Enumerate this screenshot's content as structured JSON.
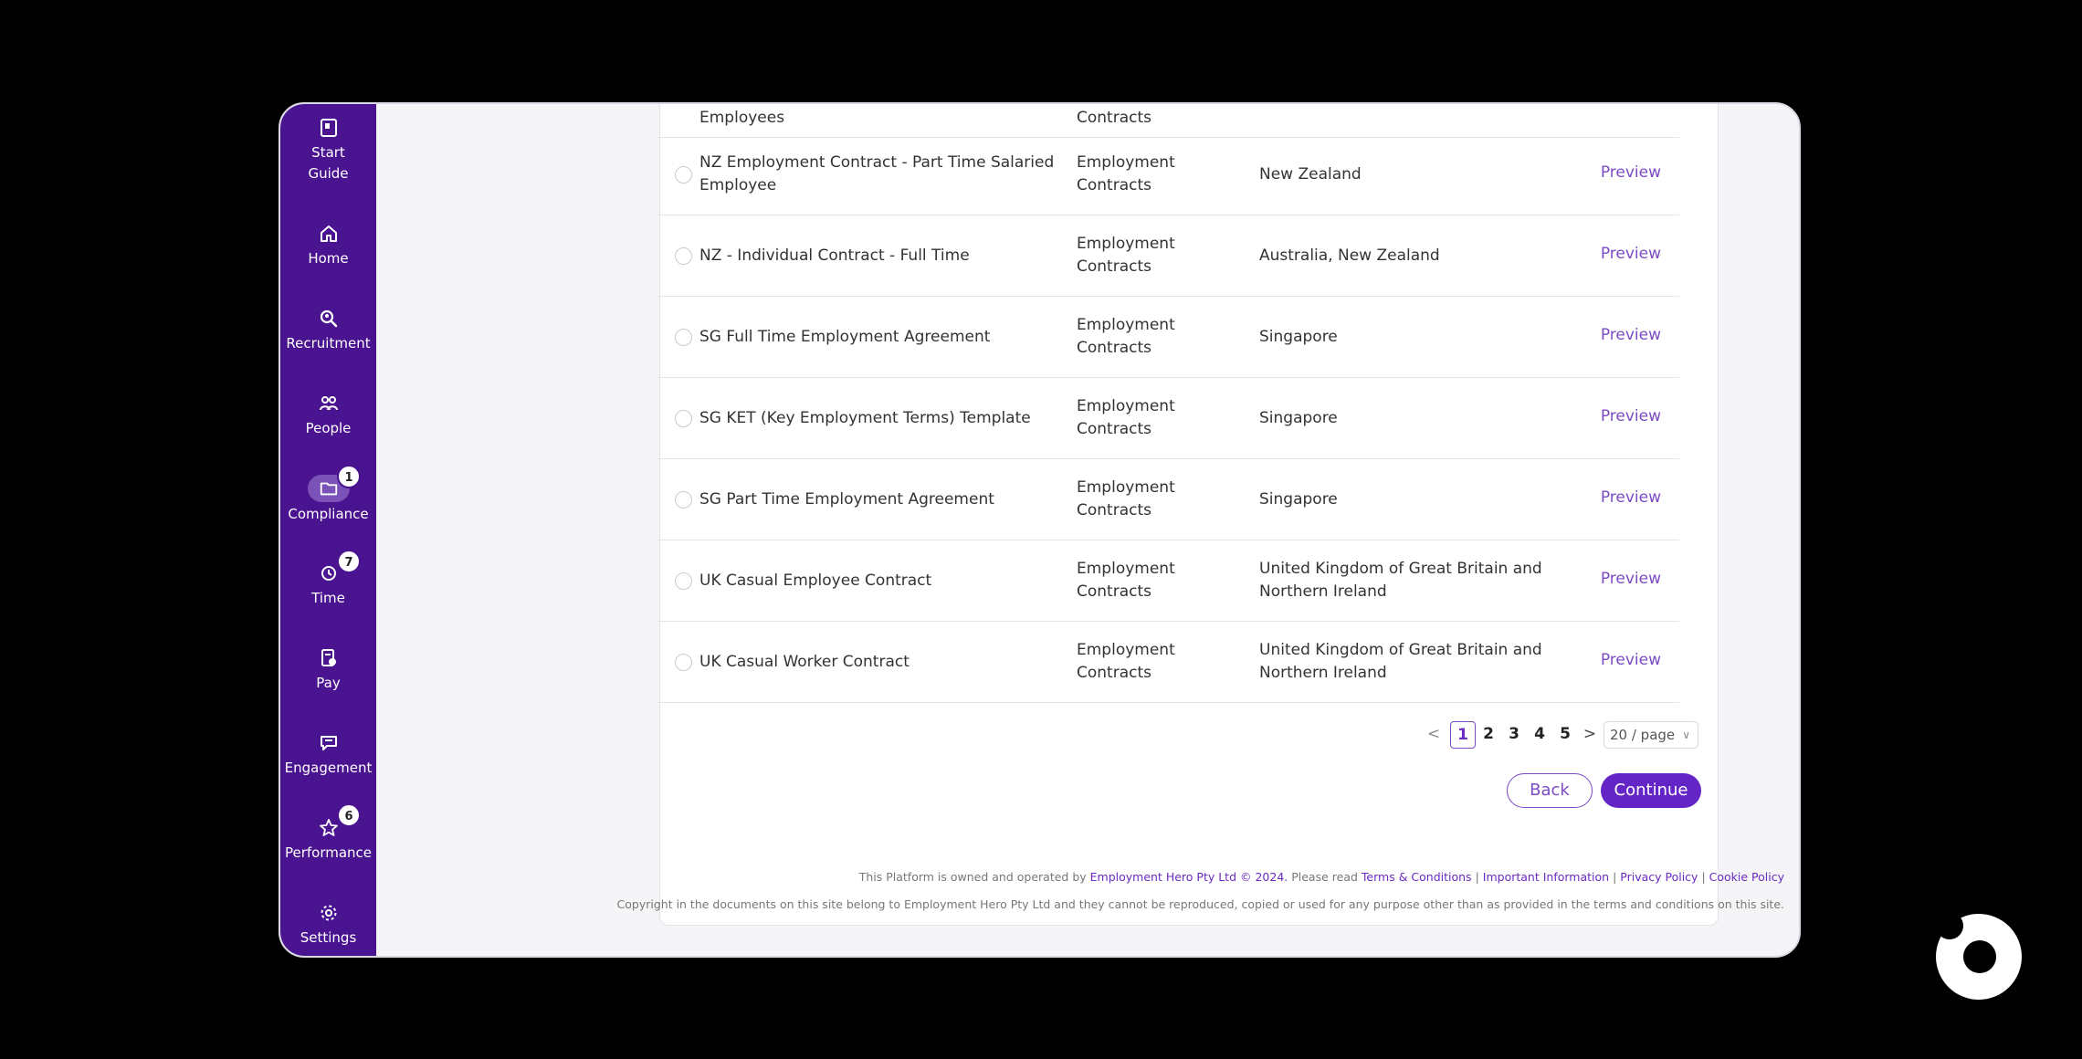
{
  "sidebar": {
    "items": [
      {
        "label": "Start Guide",
        "icon": "book-icon"
      },
      {
        "label": "Home",
        "icon": "home-icon"
      },
      {
        "label": "Recruitment",
        "icon": "search-person-icon"
      },
      {
        "label": "People",
        "icon": "people-icon"
      },
      {
        "label": "Compliance",
        "icon": "folder-icon",
        "badge": "1"
      },
      {
        "label": "Time",
        "icon": "clock-icon",
        "badge": "7"
      },
      {
        "label": "Pay",
        "icon": "payslip-icon"
      },
      {
        "label": "Engagement",
        "icon": "chat-icon"
      },
      {
        "label": "Performance",
        "icon": "star-icon",
        "badge": "6"
      },
      {
        "label": "Settings",
        "icon": "gear-icon"
      }
    ]
  },
  "table": {
    "partial_row": {
      "name": "Employees",
      "category": "Contracts"
    },
    "rows": [
      {
        "name": "NZ Employment Contract - Part Time Salaried Employee",
        "category": "Employment Contracts",
        "country": "New Zealand",
        "action": "Preview"
      },
      {
        "name": "NZ - Individual Contract - Full Time",
        "category": "Employment Contracts",
        "country": "Australia, New Zealand",
        "action": "Preview"
      },
      {
        "name": "SG Full Time Employment Agreement",
        "category": "Employment Contracts",
        "country": "Singapore",
        "action": "Preview"
      },
      {
        "name": "SG KET (Key Employment Terms) Template",
        "category": "Employment Contracts",
        "country": "Singapore",
        "action": "Preview"
      },
      {
        "name": "SG Part Time Employment Agreement",
        "category": "Employment Contracts",
        "country": "Singapore",
        "action": "Preview"
      },
      {
        "name": "UK Casual Employee Contract",
        "category": "Employment Contracts",
        "country": "United Kingdom of Great Britain and Northern Ireland",
        "action": "Preview"
      },
      {
        "name": "UK Casual Worker Contract",
        "category": "Employment Contracts",
        "country": "United Kingdom of Great Britain and Northern Ireland",
        "action": "Preview"
      }
    ]
  },
  "pagination": {
    "prev": "<",
    "pages": [
      "1",
      "2",
      "3",
      "4",
      "5"
    ],
    "current": "1",
    "next": ">",
    "page_size": "20 / page"
  },
  "buttons": {
    "back": "Back",
    "continue": "Continue"
  },
  "footer": {
    "line1_prefix": "This Platform is owned and operated by",
    "company": "Employment Hero Pty Ltd © 2024.",
    "read": "Please read",
    "terms": "Terms & Conditions",
    "important": "Important Information",
    "privacy": "Privacy Policy",
    "cookie": "Cookie Policy",
    "separator": "|",
    "line2": "Copyright in the documents on this site belong to Employment Hero Pty Ltd and they cannot be reproduced, copied or used for any purpose other than as provided in the terms and conditions on this site."
  },
  "colors": {
    "brand": "#4a1390",
    "accent": "#6425c6",
    "link": "#7b4bc4"
  }
}
